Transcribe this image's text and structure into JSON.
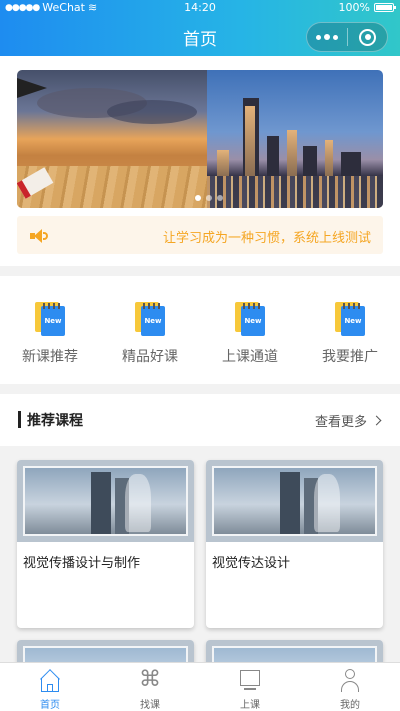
{
  "status_bar": {
    "carrier": "WeChat",
    "time": "14:20",
    "battery": "100%"
  },
  "nav": {
    "title": "首页"
  },
  "notice": {
    "text": "让学习成为一种习惯，系统上线测试"
  },
  "menu": {
    "items": [
      {
        "label": "新课推荐",
        "icon": "book-icon"
      },
      {
        "label": "精品好课",
        "icon": "book-icon"
      },
      {
        "label": "上课通道",
        "icon": "book-icon"
      },
      {
        "label": "我要推广",
        "icon": "book-icon"
      }
    ]
  },
  "section": {
    "title": "推荐课程",
    "more": "查看更多"
  },
  "courses": [
    {
      "title": "视觉传播设计与制作"
    },
    {
      "title": "视觉传达设计"
    }
  ],
  "tab_bar": {
    "active_color": "#2d8cf0",
    "items": [
      {
        "label": "首页",
        "icon": "home-icon",
        "active": true
      },
      {
        "label": "找课",
        "icon": "command-icon",
        "active": false
      },
      {
        "label": "上课",
        "icon": "monitor-icon",
        "active": false
      },
      {
        "label": "我的",
        "icon": "user-icon",
        "active": false
      }
    ]
  },
  "colors": {
    "nav_gradient_start": "#1e8cf0",
    "nav_gradient_end": "#31c7c9",
    "notice_text": "#f5a623"
  }
}
